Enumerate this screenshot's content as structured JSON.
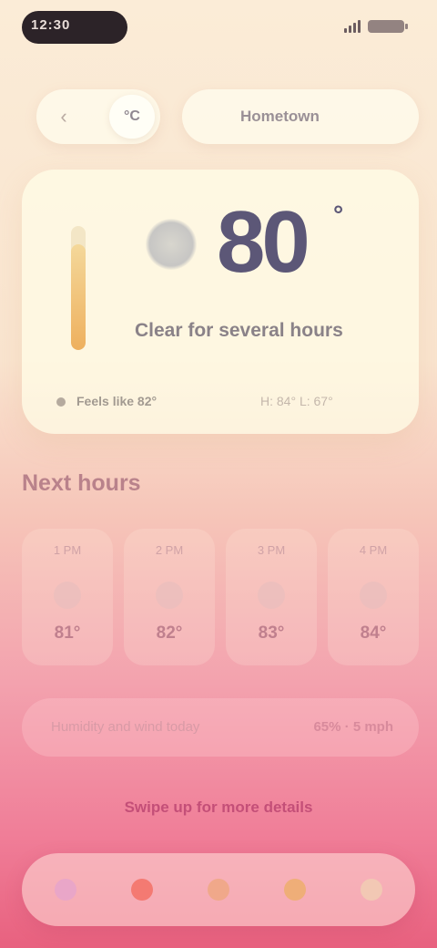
{
  "status_bar": {
    "time": "12:30"
  },
  "top": {
    "back_icon": "back-arrow-icon",
    "segment_label": "°C",
    "location": "Hometown"
  },
  "current": {
    "temperature": "80",
    "unit": "°",
    "condition": "Clear for several hours",
    "thermometer_level": 0.85,
    "footer_left": "Feels like 82°",
    "footer_right": "H: 84°  L: 67°"
  },
  "forecast": {
    "title": "Next hours",
    "items": [
      {
        "time": "1 PM",
        "icon": "sun-icon",
        "temp": "81°"
      },
      {
        "time": "2 PM",
        "icon": "sun-icon",
        "temp": "82°"
      },
      {
        "time": "3 PM",
        "icon": "sun-icon",
        "temp": "83°"
      },
      {
        "time": "4 PM",
        "icon": "sun-icon",
        "temp": "84°"
      }
    ]
  },
  "info": {
    "label": "Humidity and wind today",
    "value": "65% · 5 mph"
  },
  "hint": "Swipe up for more details",
  "nav": {
    "items": [
      {
        "name": "home",
        "icon": "home-icon",
        "color": "#e9a6c8"
      },
      {
        "name": "alerts",
        "icon": "alert-icon",
        "color": "#f47a72"
      },
      {
        "name": "radar",
        "icon": "radar-icon",
        "color": "#f0a88a"
      },
      {
        "name": "sun",
        "icon": "sun-icon",
        "color": "#efae78"
      },
      {
        "name": "settings",
        "icon": "settings-icon",
        "color": "#f2c8b4"
      }
    ]
  },
  "colors": {
    "temperature": "#5c5777",
    "accent": "#c44f78",
    "section_title": "#b9828b"
  }
}
